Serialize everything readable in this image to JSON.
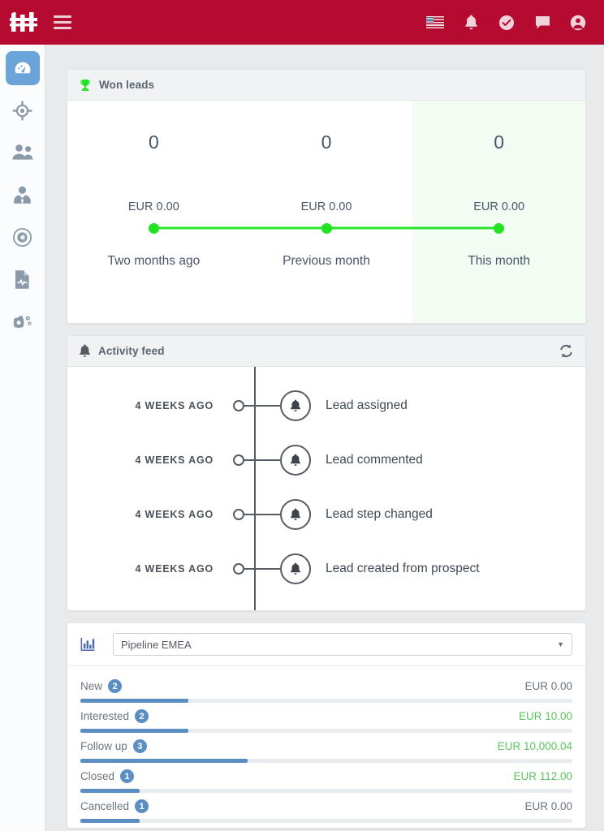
{
  "topbar": {
    "logo_alt": "company-logo",
    "menu_label": "",
    "icons": [
      {
        "name": "language-flag-icon",
        "label": "US"
      },
      {
        "name": "notifications-bell-icon",
        "label": ""
      },
      {
        "name": "tasks-check-icon",
        "label": ""
      },
      {
        "name": "messages-chat-icon",
        "label": ""
      },
      {
        "name": "account-user-icon",
        "label": ""
      }
    ]
  },
  "sidebar": {
    "items": [
      {
        "name": "dashboard",
        "icon": "dashboard-gauge-icon",
        "active": true
      },
      {
        "name": "targets",
        "icon": "crosshair-target-icon",
        "active": false
      },
      {
        "name": "leads",
        "icon": "users-group-icon",
        "active": false
      },
      {
        "name": "contacts",
        "icon": "person-tie-icon",
        "active": false
      },
      {
        "name": "campaigns",
        "icon": "circle-target-icon",
        "active": false
      },
      {
        "name": "reports",
        "icon": "document-chart-icon",
        "active": false
      },
      {
        "name": "settings",
        "icon": "gears-settings-icon",
        "active": false
      }
    ]
  },
  "won_leads": {
    "title": "Won leads",
    "icon": "trophy-icon",
    "accent_color": "#22e222",
    "columns": [
      {
        "count": "0",
        "amount": "EUR 0.00",
        "label": "Two months ago",
        "highlight": false
      },
      {
        "count": "0",
        "amount": "EUR 0.00",
        "label": "Previous month",
        "highlight": false
      },
      {
        "count": "0",
        "amount": "EUR 0.00",
        "label": "This month",
        "highlight": true
      }
    ]
  },
  "activity_feed": {
    "title": "Activity feed",
    "icon": "bell-icon",
    "refresh_icon": "refresh-sync-icon",
    "items": [
      {
        "time": "4 WEEKS AGO",
        "text": "Lead assigned",
        "icon": "bell-icon"
      },
      {
        "time": "4 WEEKS AGO",
        "text": "Lead commented",
        "icon": "bell-icon"
      },
      {
        "time": "4 WEEKS AGO",
        "text": "Lead step changed",
        "icon": "bell-icon"
      },
      {
        "time": "4 WEEKS AGO",
        "text": "Lead created from prospect",
        "icon": "bell-icon"
      }
    ]
  },
  "pipeline": {
    "icon": "bar-chart-icon",
    "selected": "Pipeline EMEA",
    "caret": "▼",
    "bar_color": "#5b8fc4",
    "rows": [
      {
        "name": "New",
        "count": "2",
        "value": "EUR 0.00",
        "value_color": "grey",
        "fill_pct": 22
      },
      {
        "name": "Interested",
        "count": "2",
        "value": "EUR 10.00",
        "value_color": "green",
        "fill_pct": 22
      },
      {
        "name": "Follow up",
        "count": "3",
        "value": "EUR 10,000.04",
        "value_color": "green",
        "fill_pct": 34
      },
      {
        "name": "Closed",
        "count": "1",
        "value": "EUR 112.00",
        "value_color": "green",
        "fill_pct": 12
      },
      {
        "name": "Cancelled",
        "count": "1",
        "value": "EUR 0.00",
        "value_color": "grey",
        "fill_pct": 12
      }
    ]
  }
}
